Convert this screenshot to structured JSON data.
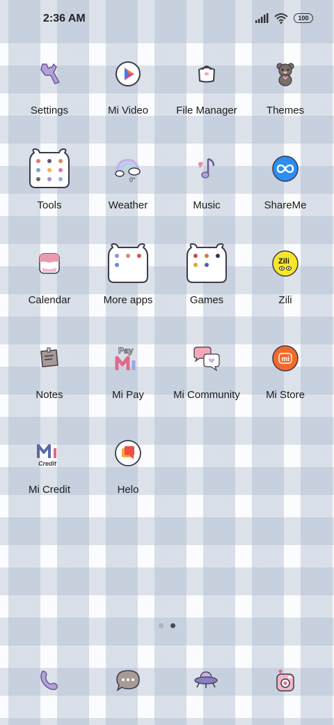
{
  "status": {
    "time": "2:36 AM",
    "battery": "100"
  },
  "apps": [
    {
      "label": "Settings",
      "icon": "wrench-icon"
    },
    {
      "label": "Mi Video",
      "icon": "mi-video-icon"
    },
    {
      "label": "File Manager",
      "icon": "bag-icon"
    },
    {
      "label": "Themes",
      "icon": "bear-icon"
    },
    {
      "label": "Tools",
      "icon": "folder-icon"
    },
    {
      "label": "Weather",
      "icon": "rainbow-icon",
      "temp": "0°"
    },
    {
      "label": "Music",
      "icon": "music-note-icon"
    },
    {
      "label": "ShareMe",
      "icon": "infinity-icon"
    },
    {
      "label": "Calendar",
      "icon": "calendar-icon"
    },
    {
      "label": "More apps",
      "icon": "folder-icon"
    },
    {
      "label": "Games",
      "icon": "folder-icon"
    },
    {
      "label": "Zili",
      "icon": "zili-icon",
      "badge": "Zili"
    },
    {
      "label": "Notes",
      "icon": "notes-icon"
    },
    {
      "label": "Mi Pay",
      "icon": "mi-pay-icon",
      "badge": "Pay"
    },
    {
      "label": "Mi Community",
      "icon": "chat-bubbles-icon"
    },
    {
      "label": "Mi Store",
      "icon": "mi-store-icon",
      "badge": "mi"
    },
    {
      "label": "Mi Credit",
      "icon": "mi-credit-icon",
      "badge": "Credit"
    },
    {
      "label": "Helo",
      "icon": "helo-icon"
    }
  ],
  "dock": [
    {
      "icon": "phone-icon"
    },
    {
      "icon": "messages-icon"
    },
    {
      "icon": "browser-ufo-icon"
    },
    {
      "icon": "camera-icon"
    }
  ],
  "pager": {
    "count": 2,
    "active": 2
  }
}
